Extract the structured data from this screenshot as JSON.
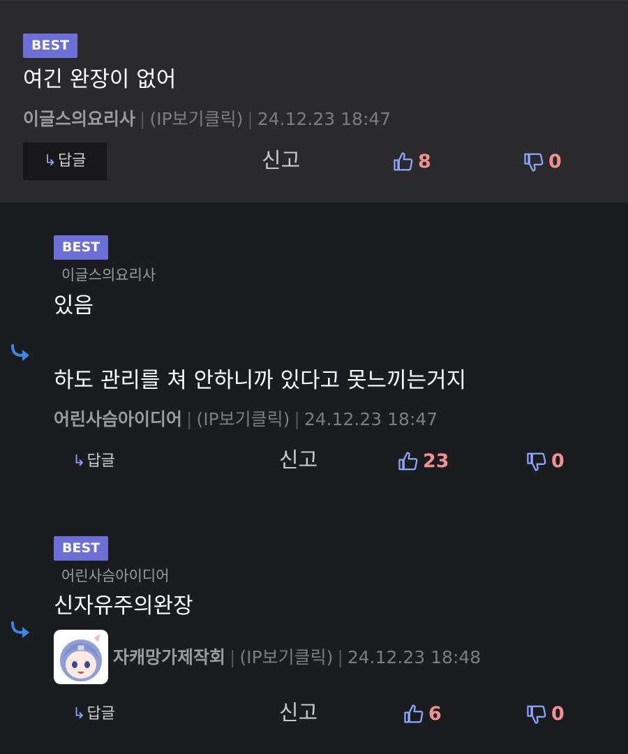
{
  "colors": {
    "badge": "#6b6fd6",
    "vote_count": "#f19090",
    "reply_arrow": "#8ea6ff",
    "thread_arrow": "#3d86e8"
  },
  "comments": [
    {
      "badge": "BEST",
      "text": "여긴 완장이 없어",
      "author": "이글스의요리사",
      "ip": "(IP보기클릭)",
      "date": "24.12.23 18:47",
      "reply_label": "답글",
      "report_label": "신고",
      "likes": "8",
      "dislikes": "0"
    },
    {
      "badge": "BEST",
      "parent_author": "이글스의요리사",
      "line1": "있음",
      "line2": "하도 관리를 쳐 안하니까 있다고 못느끼는거지",
      "author": "어린사슴아이디어",
      "ip": "(IP보기클릭)",
      "date": "24.12.23 18:47",
      "reply_label": "답글",
      "report_label": "신고",
      "likes": "23",
      "dislikes": "0"
    },
    {
      "badge": "BEST",
      "parent_author": "어린사슴아이디어",
      "text": "신자유주의완장",
      "author": "자캐망가제작회",
      "ip": "(IP보기클릭)",
      "date": "24.12.23 18:48",
      "reply_label": "답글",
      "report_label": "신고",
      "likes": "6",
      "dislikes": "0"
    }
  ]
}
